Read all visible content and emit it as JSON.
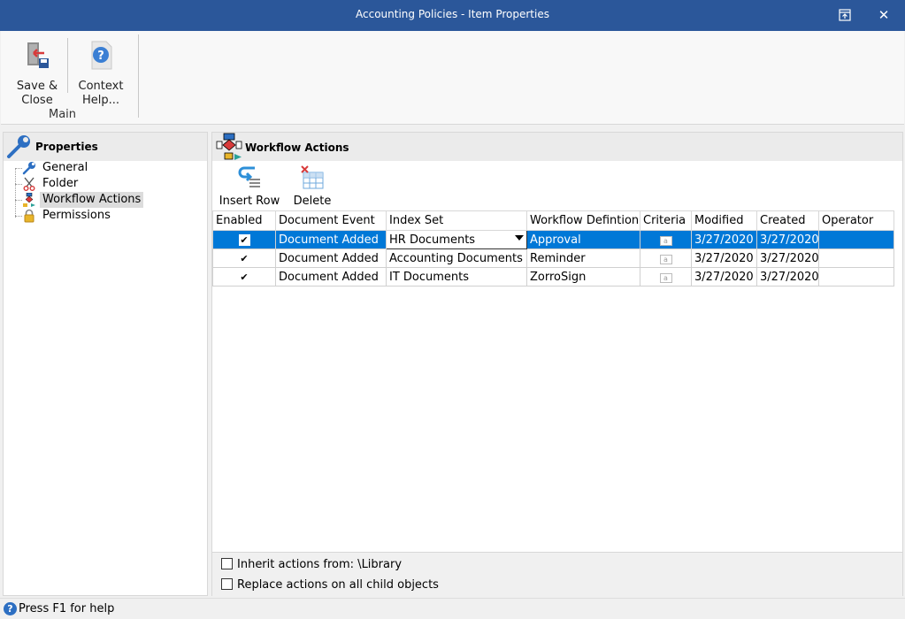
{
  "window": {
    "title": "Accounting Policies - Item Properties",
    "restore_icon": "restore-window-icon",
    "close_icon": "close-icon"
  },
  "ribbon": {
    "save_close": {
      "line1": "Save &",
      "line2": "Close",
      "icon": "save-close-icon"
    },
    "context_help": {
      "line1": "Context",
      "line2": "Help...",
      "icon": "help-icon"
    },
    "group_label": "Main"
  },
  "properties_panel": {
    "title": "Properties",
    "items": [
      {
        "label": "General",
        "icon": "wrench-icon",
        "selected": false
      },
      {
        "label": "Folder",
        "icon": "scissors-icon",
        "selected": false
      },
      {
        "label": "Workflow Actions",
        "icon": "workflow-icon",
        "selected": true
      },
      {
        "label": "Permissions",
        "icon": "lock-icon",
        "selected": false
      }
    ]
  },
  "workflow_panel": {
    "title": "Workflow Actions",
    "toolbar": {
      "insert_row": "Insert Row",
      "delete": "Delete"
    },
    "columns": [
      "Enabled",
      "Document Event",
      "Index Set",
      "Workflow Defintion",
      "Criteria",
      "Modified",
      "Created",
      "Operator"
    ],
    "rows": [
      {
        "enabled": true,
        "event": "Document Added",
        "index_set": "HR Documents",
        "workflow": "Approval",
        "modified": "3/27/2020",
        "created": "3/27/2020",
        "operator": "",
        "selected": true
      },
      {
        "enabled": true,
        "event": "Document Added",
        "index_set": "Accounting Documents",
        "workflow": "Reminder",
        "modified": "3/27/2020",
        "created": "3/27/2020",
        "operator": "",
        "selected": false
      },
      {
        "enabled": true,
        "event": "Document Added",
        "index_set": "IT Documents",
        "workflow": "ZorroSign",
        "modified": "3/27/2020",
        "created": "3/27/2020",
        "operator": "",
        "selected": false
      }
    ],
    "inherit_label": "Inherit actions from: \\Library",
    "replace_label": "Replace actions on all child objects"
  },
  "status_bar": {
    "text": "Press F1 for help"
  },
  "colors": {
    "titlebar": "#2b579a",
    "selection": "#0078d7"
  }
}
